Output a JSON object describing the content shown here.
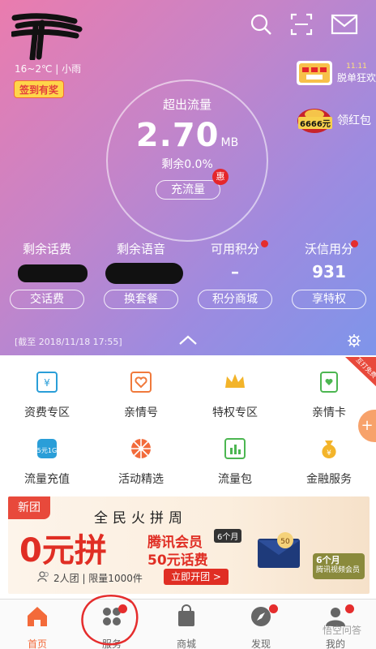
{
  "header": {
    "weather": "16~2℃ | 小雨",
    "checkin": "签到有奖",
    "icons": [
      "search-icon",
      "scan-icon",
      "mail-icon"
    ]
  },
  "side_promos": [
    {
      "badge": "11.11",
      "label": "脱单狂欢"
    },
    {
      "badge": "6666元",
      "label": "领红包"
    }
  ],
  "traffic": {
    "title": "超出流量",
    "value": "2.70",
    "unit": "MB",
    "remain": "剩余0.0%",
    "recharge": "充流量",
    "badge": "惠"
  },
  "stats": [
    {
      "label": "剩余话费",
      "value": "",
      "button": "交话费"
    },
    {
      "label": "剩余语音",
      "value": "",
      "button": "换套餐"
    },
    {
      "label": "可用积分",
      "value": "–",
      "button": "积分商城"
    },
    {
      "label": "沃信用分",
      "value": "931",
      "button": "享特权"
    }
  ],
  "asof": "[截至 2018/11/18 17:55]",
  "corner_tag": "互打免费",
  "services": [
    {
      "label": "资费专区",
      "icon": "tariff-icon"
    },
    {
      "label": "亲情号",
      "icon": "family-icon"
    },
    {
      "label": "特权专区",
      "icon": "crown-icon"
    },
    {
      "label": "亲情卡",
      "icon": "card-icon"
    },
    {
      "label": "流量充值",
      "icon": "data-recharge-icon"
    },
    {
      "label": "活动精选",
      "icon": "wheel-icon"
    },
    {
      "label": "流量包",
      "icon": "data-pack-icon"
    },
    {
      "label": "金融服务",
      "icon": "money-bag-icon"
    }
  ],
  "banner": {
    "tag": "新团",
    "title": "全民火拼周",
    "zero": "0元拼",
    "member": "腾讯会员",
    "months": "6个月",
    "fee": "50元话费",
    "group": "2人团 | 限量1000件",
    "cta": "立即开团 >",
    "video_line1": "6个月",
    "video_line2": "腾讯视频会员"
  },
  "tabs": [
    {
      "label": "首页",
      "icon": "home-icon"
    },
    {
      "label": "服务",
      "icon": "services-icon"
    },
    {
      "label": "商城",
      "icon": "shop-icon"
    },
    {
      "label": "发现",
      "icon": "compass-icon"
    },
    {
      "label": "我的",
      "icon": "profile-icon"
    }
  ],
  "watermark": "悟空问答",
  "colors": {
    "accent": "#f36a3a",
    "red": "#e52d2d",
    "gradient_start": "#ea7cae",
    "gradient_end": "#7e95ea"
  }
}
